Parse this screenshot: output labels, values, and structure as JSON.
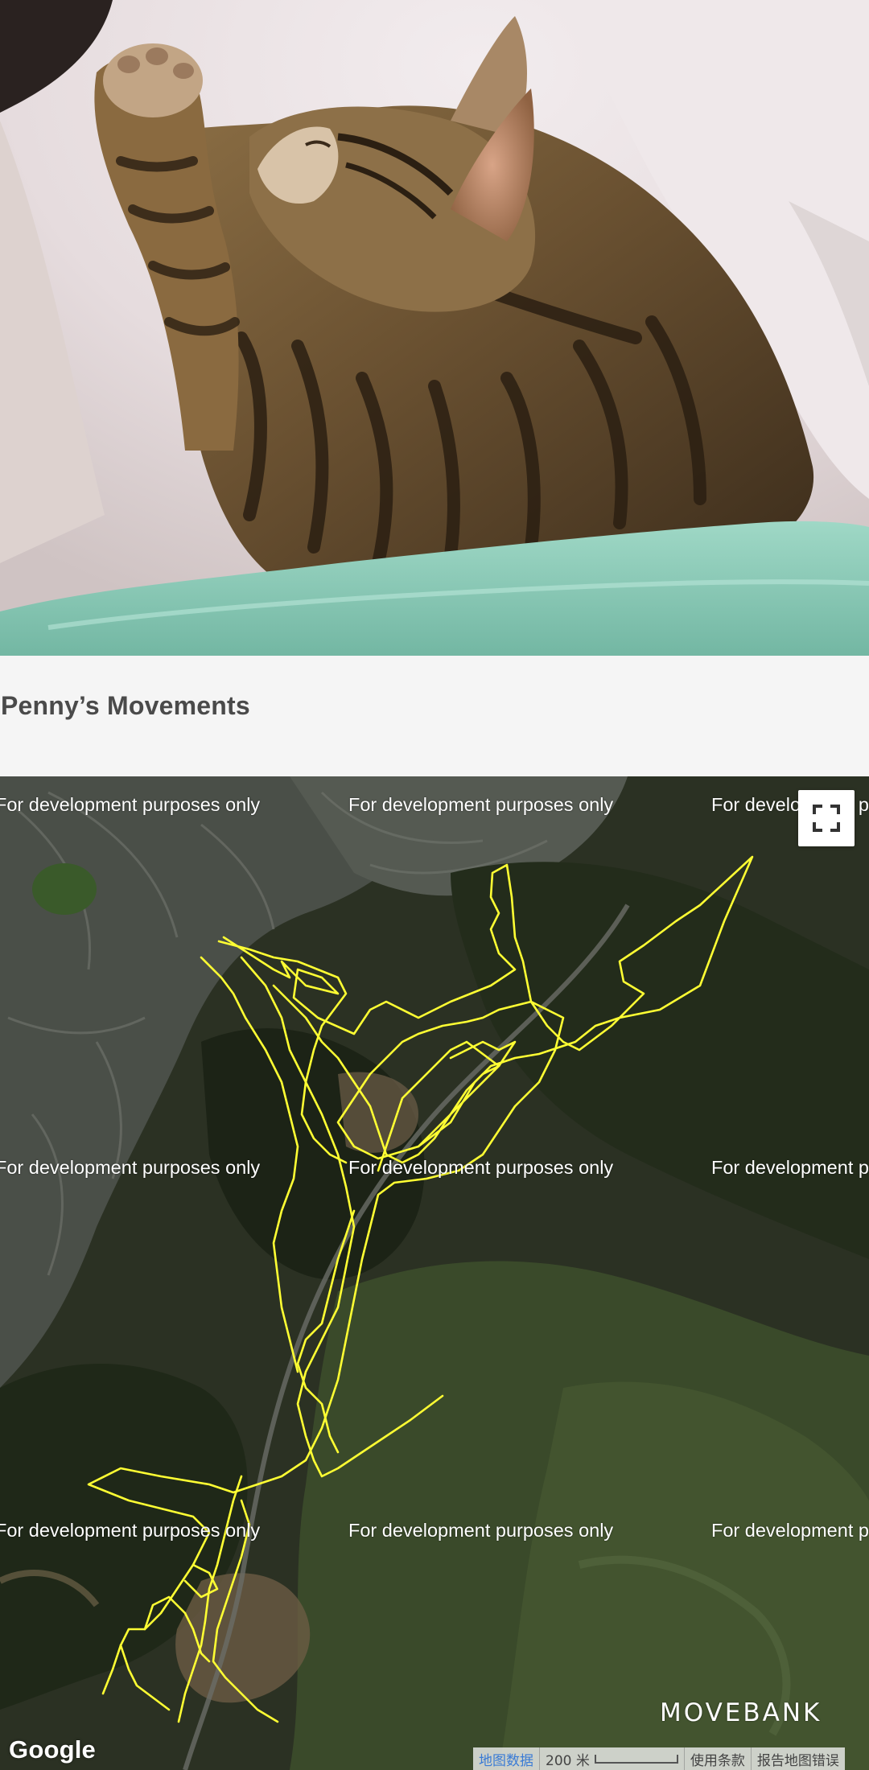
{
  "page": {
    "title": "Penny’s Movements"
  },
  "photo": {
    "subject": "tabby-cat-sleeping-on-blanket"
  },
  "map": {
    "watermark_text": "For development purposes only",
    "track_color": "#ffff33",
    "provider_logo": "Google",
    "brand_logo": "MOVEBANK",
    "fullscreen_icon": "fullscreen-icon",
    "attribution": {
      "map_data_link": "地图数据",
      "scale_label": "200 米",
      "terms_link": "使用条款",
      "report_link": "报告地图错误"
    }
  },
  "colors": {
    "title_text": "#4a4a4a",
    "title_background": "#f5f5f5",
    "attribution_link": "#3a7bd5"
  }
}
